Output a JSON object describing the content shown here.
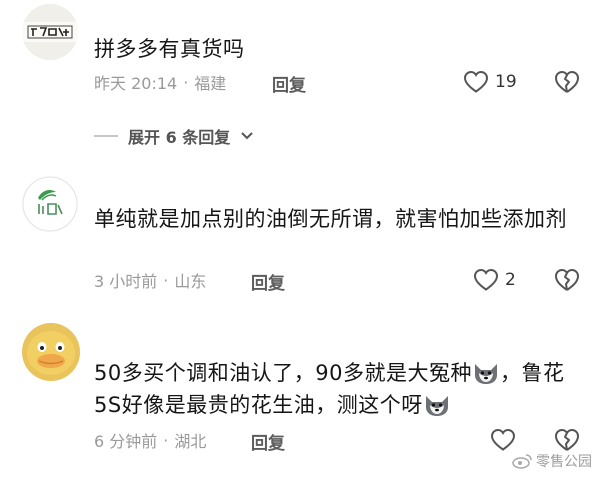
{
  "comments": [
    {
      "avatar": "avatar-shop-sign",
      "text": "拼多多有真货吗",
      "time": "昨天 20:14",
      "sep": "·",
      "location": "福建",
      "reply_label": "回复",
      "likes": "19",
      "expand_label": "展开 6 条回复"
    },
    {
      "avatar": "avatar-green-logo",
      "text": "单纯就是加点别的油倒无所谓，就害怕加些添加剂",
      "time": "3 小时前",
      "sep": "·",
      "location": "山东",
      "reply_label": "回复",
      "likes": "2"
    },
    {
      "avatar": "avatar-duck",
      "text_before_emoji1": "50多买个调和油认了，90多就是大冤种",
      "text_between": "，鲁花5S好像是最贵的花生油，测这个呀",
      "emoji_icon": "husky-emoji-icon",
      "time": "6 分钟前",
      "sep": "·",
      "location": "湖北",
      "reply_label": "回复",
      "likes": ""
    }
  ],
  "watermark": {
    "icon": "weibo-icon",
    "text": "零售公园"
  },
  "colors": {
    "meta": "#9a9a9a",
    "text": "#161616",
    "icon": "#555555"
  }
}
